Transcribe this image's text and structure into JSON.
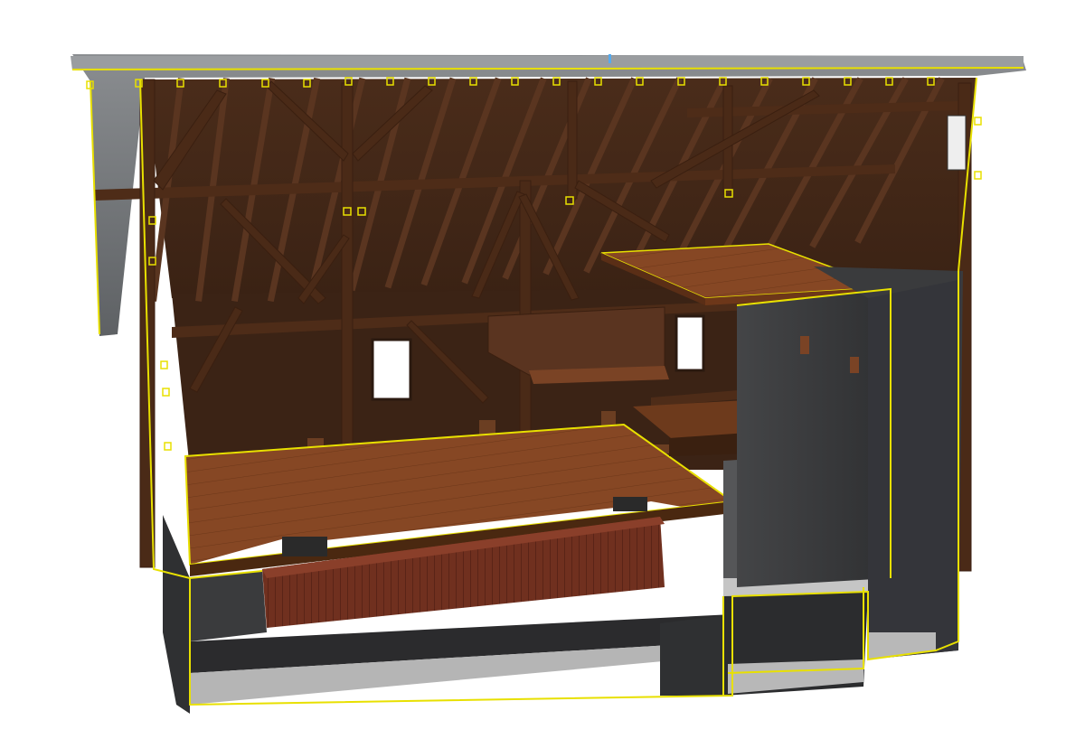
{
  "scene": {
    "kind": "3d-section-model",
    "subject": "timber-frame-barn-interior",
    "colors": {
      "background": "#ffffff",
      "roof_outer": "#6f7276",
      "wall_grey": "#3c3d3f",
      "wall_dark": "#2e2f31",
      "timber": "#4a2a17",
      "timber_light": "#6b3e22",
      "rafter": "#4b2d1b",
      "floor": "#8a4a26",
      "floor_dark": "#6a3618",
      "brick": "#6e2f22",
      "section_outline": "#e8e000",
      "concrete": "#b8b8b8",
      "window": "#ffffff"
    }
  }
}
